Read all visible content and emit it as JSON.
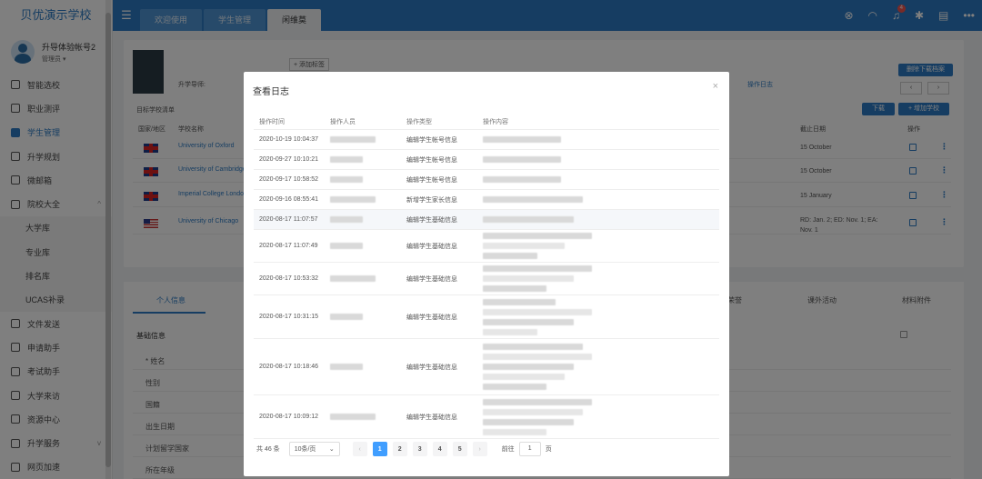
{
  "sidebar": {
    "school_name": "贝优演示学校",
    "user": {
      "name": "升导体验帐号2",
      "role": "管理员 ▾"
    },
    "items": [
      {
        "label": "智能选校"
      },
      {
        "label": "职业测评"
      },
      {
        "label": "学生管理",
        "active": true
      },
      {
        "label": "升学规划"
      },
      {
        "label": "微邮箱"
      },
      {
        "label": "院校大全",
        "caret": "^"
      },
      {
        "label": "大学库",
        "sub": true
      },
      {
        "label": "专业库",
        "sub": true
      },
      {
        "label": "排名库",
        "sub": true
      },
      {
        "label": "UCAS补录",
        "sub": true
      },
      {
        "label": "文件发送"
      },
      {
        "label": "申请助手"
      },
      {
        "label": "考试助手"
      },
      {
        "label": "大学来访"
      },
      {
        "label": "资源中心"
      },
      {
        "label": "升学服务",
        "caret": "v"
      },
      {
        "label": "网页加速"
      }
    ]
  },
  "topbar": {
    "tabs": [
      {
        "label": "欢迎使用"
      },
      {
        "label": "学生管理"
      },
      {
        "label": "闲维莫",
        "active": true
      }
    ],
    "notification_count": "4"
  },
  "background": {
    "tag_add": "+ 添加标签",
    "student_label": "升学导师:",
    "op_log_link": "操作日志",
    "download_file_btn": "删除下载档案",
    "download_btn": "下载",
    "add_school_btn": "+ 增加学校",
    "target_title": "目标学校清单",
    "col_country": "国家/地区",
    "col_school": "学校名称",
    "col_deadline": "截止日期",
    "col_action": "操作",
    "schools": [
      {
        "name": "University of Oxford",
        "flag": "uk",
        "deadline": "15 October"
      },
      {
        "name": "University of Cambridge",
        "flag": "uk",
        "deadline": "15 October"
      },
      {
        "name": "Imperial College London",
        "flag": "uk",
        "deadline": "15 January"
      },
      {
        "name": "University of Chicago",
        "flag": "us",
        "deadline": "RD: Jan. 2; ED: Nov. 1; EA: Nov. 1"
      }
    ],
    "section_tabs": [
      "个人信息",
      "荣誉",
      "课外活动",
      "材料附件"
    ],
    "basic_info": "基础信息",
    "fields": [
      "* 姓名",
      "性别",
      "国籍",
      "出生日期",
      "计划留学国家",
      "所在年级"
    ]
  },
  "modal": {
    "title": "查看日志",
    "close_icon": "×",
    "columns": {
      "time": "操作时间",
      "operator": "操作人员",
      "type": "操作类型",
      "content": "操作内容"
    },
    "rows": [
      {
        "time": "2020-10-19 10:04:37",
        "type": "编辑学生帐号信息",
        "lines": 1
      },
      {
        "time": "2020-09-27 10:10:21",
        "type": "编辑学生帐号信息",
        "lines": 1
      },
      {
        "time": "2020-09-17 10:58:52",
        "type": "编辑学生帐号信息",
        "lines": 1
      },
      {
        "time": "2020-09-16 08:55:41",
        "type": "新增学生家长信息",
        "lines": 1
      },
      {
        "time": "2020-08-17 11:07:57",
        "type": "编辑学生基础信息",
        "lines": 1,
        "highlight": true
      },
      {
        "time": "2020-08-17 11:07:49",
        "type": "编辑学生基础信息",
        "lines": 3
      },
      {
        "time": "2020-08-17 10:53:32",
        "type": "编辑学生基础信息",
        "lines": 3
      },
      {
        "time": "2020-08-17 10:31:15",
        "type": "编辑学生基础信息",
        "lines": 4
      },
      {
        "time": "2020-08-17 10:18:46",
        "type": "编辑学生基础信息",
        "lines": 5
      },
      {
        "time": "2020-08-17 10:09:12",
        "type": "编辑学生基础信息",
        "lines": 4
      }
    ],
    "pagination": {
      "total": "共 46 条",
      "page_size": "10条/页",
      "pages": [
        "1",
        "2",
        "3",
        "4",
        "5"
      ],
      "current": "1",
      "goto_label": "前往",
      "goto_value": "1",
      "page_unit": "页"
    }
  }
}
